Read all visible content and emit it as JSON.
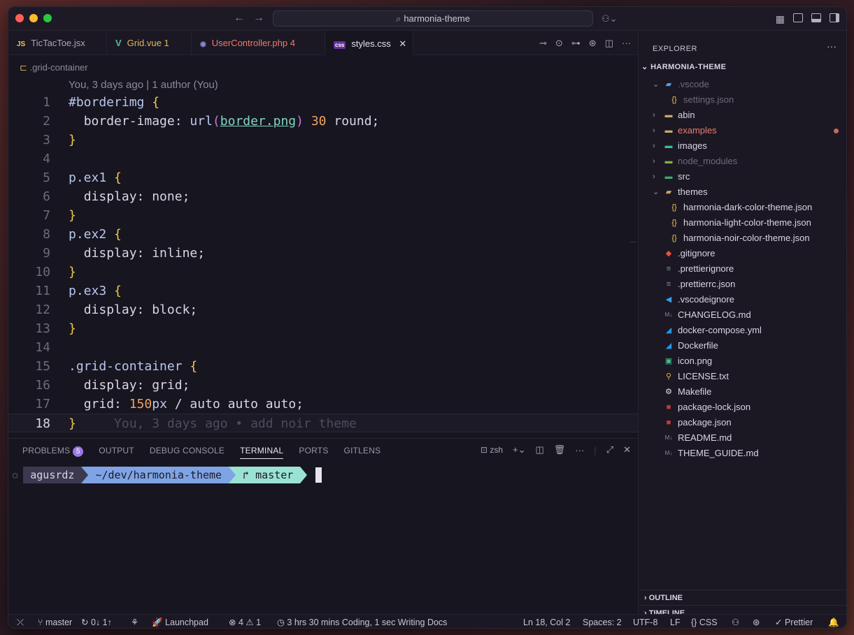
{
  "window": {
    "command_center": "harmonia-theme"
  },
  "tabs": [
    {
      "icon": "JS",
      "label": "TicTacToe.jsx",
      "badge": ""
    },
    {
      "icon": "V",
      "label": "Grid.vue",
      "badge": "1"
    },
    {
      "icon": "php",
      "label": "UserController.php",
      "badge": "4"
    },
    {
      "icon": "css",
      "label": "styles.css",
      "badge": ""
    }
  ],
  "breadcrumb": ".grid-container",
  "blame_header": "You, 3 days ago | 1 author (You)",
  "code": {
    "line_numbers": [
      "1",
      "2",
      "3",
      "4",
      "5",
      "6",
      "7",
      "8",
      "9",
      "10",
      "11",
      "12",
      "13",
      "14",
      "15",
      "16",
      "17",
      "18"
    ],
    "l1_sel": "#borderimg",
    "l2_prop": "border-image: ",
    "l2_fn": "url",
    "l2_str": "border.png",
    "l2_num": "30",
    "l2_rest": " round;",
    "l5_sel": "p.ex1",
    "l6": "display: none;",
    "l8_sel": "p.ex2",
    "l9": "display: inline;",
    "l11_sel": "p.ex3",
    "l12": "display: block;",
    "l15_sel": ".grid-container",
    "l16": "display: grid;",
    "l17_prop": "grid: ",
    "l17_num": "150",
    "l17_unit": "px",
    "l17_rest": " / auto auto auto;",
    "ghost_blame": "You, 3 days ago • add noir theme"
  },
  "panel": {
    "tabs": [
      "PROBLEMS",
      "OUTPUT",
      "DEBUG CONSOLE",
      "TERMINAL",
      "PORTS",
      "GITLENS"
    ],
    "problems_count": "5",
    "shell": "zsh",
    "prompt_user": "agusrdz",
    "prompt_path": "~/dev/harmonia-theme",
    "prompt_branch": "master"
  },
  "explorer": {
    "title": "EXPLORER",
    "root": "HARMONIA-THEME",
    "items": [
      {
        "label": ".vscode",
        "kind": "folder-open"
      },
      {
        "label": "settings.json",
        "kind": "json"
      },
      {
        "label": "abin",
        "kind": "folder"
      },
      {
        "label": "examples",
        "kind": "folder"
      },
      {
        "label": "images",
        "kind": "folder"
      },
      {
        "label": "node_modules",
        "kind": "folder"
      },
      {
        "label": "src",
        "kind": "folder"
      },
      {
        "label": "themes",
        "kind": "folder-open"
      },
      {
        "label": "harmonia-dark-color-theme.json",
        "kind": "json"
      },
      {
        "label": "harmonia-light-color-theme.json",
        "kind": "json"
      },
      {
        "label": "harmonia-noir-color-theme.json",
        "kind": "json"
      },
      {
        "label": ".gitignore",
        "kind": "git"
      },
      {
        "label": ".prettierignore",
        "kind": "prettier"
      },
      {
        "label": ".prettierrc.json",
        "kind": "prettier"
      },
      {
        "label": ".vscodeignore",
        "kind": "vscode"
      },
      {
        "label": "CHANGELOG.md",
        "kind": "md"
      },
      {
        "label": "docker-compose.yml",
        "kind": "docker"
      },
      {
        "label": "Dockerfile",
        "kind": "docker"
      },
      {
        "label": "icon.png",
        "kind": "image"
      },
      {
        "label": "LICENSE.txt",
        "kind": "license"
      },
      {
        "label": "Makefile",
        "kind": "make"
      },
      {
        "label": "package-lock.json",
        "kind": "npm"
      },
      {
        "label": "package.json",
        "kind": "npm"
      },
      {
        "label": "README.md",
        "kind": "md"
      },
      {
        "label": "THEME_GUIDE.md",
        "kind": "md"
      }
    ],
    "outline": "OUTLINE",
    "timeline": "TIMELINE"
  },
  "status": {
    "branch": "master",
    "sync": "0↓ 1↑",
    "launchpad": "Launchpad",
    "errors": "4",
    "warnings": "1",
    "wakatime": "3 hrs 30 mins Coding, 1 sec Writing Docs",
    "position": "Ln 18, Col 2",
    "spaces": "Spaces: 2",
    "encoding": "UTF-8",
    "eol": "LF",
    "language": "CSS",
    "formatter": "Prettier"
  },
  "colors": {
    "accent": "#9b7ae6",
    "selector": "#b8c7f0",
    "brace": "#f2c94c",
    "number": "#f0a45d"
  }
}
